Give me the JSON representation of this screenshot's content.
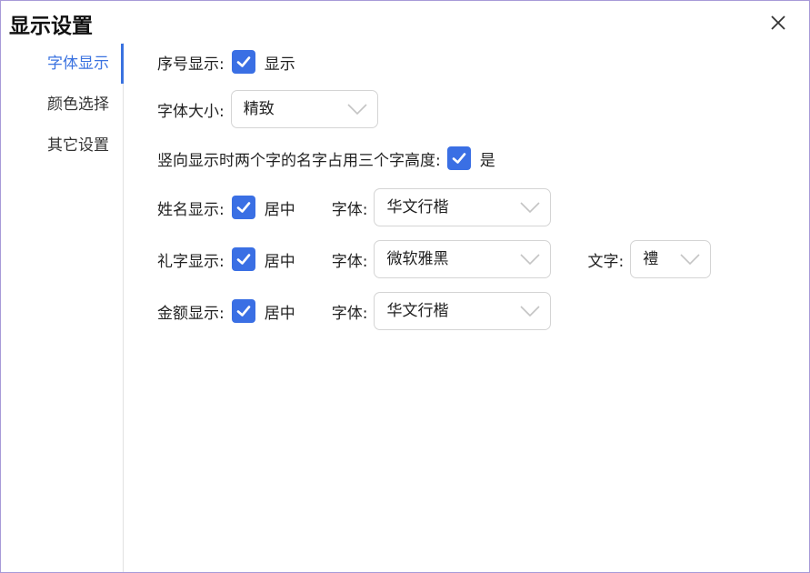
{
  "dialog": {
    "title": "显示设置"
  },
  "sidebar": {
    "items": [
      {
        "label": "字体显示",
        "active": true
      },
      {
        "label": "颜色选择",
        "active": false
      },
      {
        "label": "其它设置",
        "active": false
      }
    ]
  },
  "settings": {
    "serial": {
      "label": "序号显示:",
      "checked": true,
      "check_label": "显示"
    },
    "font_size": {
      "label": "字体大小:",
      "value": "精致"
    },
    "vertical": {
      "label": "竖向显示时两个字的名字占用三个字高度:",
      "checked": true,
      "check_label": "是"
    },
    "name": {
      "label": "姓名显示:",
      "checked": true,
      "check_label": "居中",
      "font_label": "字体:",
      "font_value": "华文行楷"
    },
    "gift": {
      "label": "礼字显示:",
      "checked": true,
      "check_label": "居中",
      "font_label": "字体:",
      "font_value": "微软雅黑",
      "text_label": "文字:",
      "text_value": "禮"
    },
    "amount": {
      "label": "金额显示:",
      "checked": true,
      "check_label": "居中",
      "font_label": "字体:",
      "font_value": "华文行楷"
    }
  },
  "colors": {
    "accent": "#3a72e0",
    "checkbox": "#3a6fe4",
    "border": "#a89ad8"
  },
  "icons": {
    "close": "close-icon",
    "check": "checkmark-icon",
    "dropdown": "chevron-down-icon"
  }
}
